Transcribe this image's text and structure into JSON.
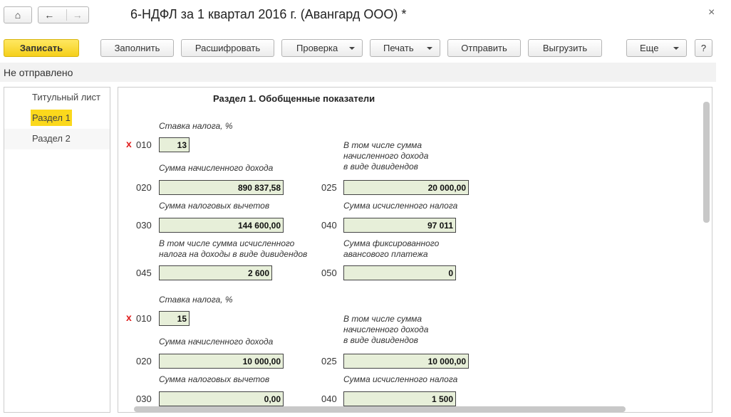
{
  "window": {
    "title": "6-НДФЛ за 1 квартал 2016 г. (Авангард ООО) *",
    "close_icon": "close-icon",
    "home_icon": "home-icon",
    "back_icon": "arrow-left-icon",
    "forward_icon": "arrow-right-icon"
  },
  "toolbar": {
    "save": "Записать",
    "fill": "Заполнить",
    "decode": "Расшифровать",
    "check": "Проверка",
    "print": "Печать",
    "send": "Отправить",
    "export": "Выгрузить",
    "more": "Еще",
    "help": "?"
  },
  "status": "Не отправлено",
  "sidebar": {
    "items": [
      {
        "label": "Титульный лист"
      },
      {
        "label": "Раздел 1",
        "selected": true
      },
      {
        "label": "Раздел 2"
      }
    ]
  },
  "document": {
    "title": "Раздел 1. Обобщенные показатели",
    "labels": {
      "rate": "Ставка налога, %",
      "income": "Сумма начисленного дохода",
      "dividend_income": [
        "В том числе сумма",
        "начисленного дохода",
        "в виде дивидендов"
      ],
      "deductions": "Сумма налоговых вычетов",
      "calc_tax": "Сумма исчисленного налога",
      "dividend_tax": [
        "В том числе сумма исчисленного",
        "налога на доходы в виде дивидендов"
      ],
      "fixed_advance": [
        "Сумма фиксированного",
        "авансового платежа"
      ]
    },
    "codes": {
      "rate": "010",
      "income": "020",
      "dividend_income": "025",
      "deductions": "030",
      "calc_tax": "040",
      "dividend_tax": "045",
      "fixed_advance": "050"
    },
    "error_mark": "x",
    "blocks": [
      {
        "rate": "13",
        "income": "890 837,58",
        "dividend_income": "20 000,00",
        "deductions": "144 600,00",
        "calc_tax": "97 011",
        "dividend_tax": "2 600",
        "fixed_advance": "0"
      },
      {
        "rate": "15",
        "income": "10 000,00",
        "dividend_income": "10 000,00",
        "deductions": "0,00",
        "calc_tax": "1 500"
      }
    ]
  }
}
